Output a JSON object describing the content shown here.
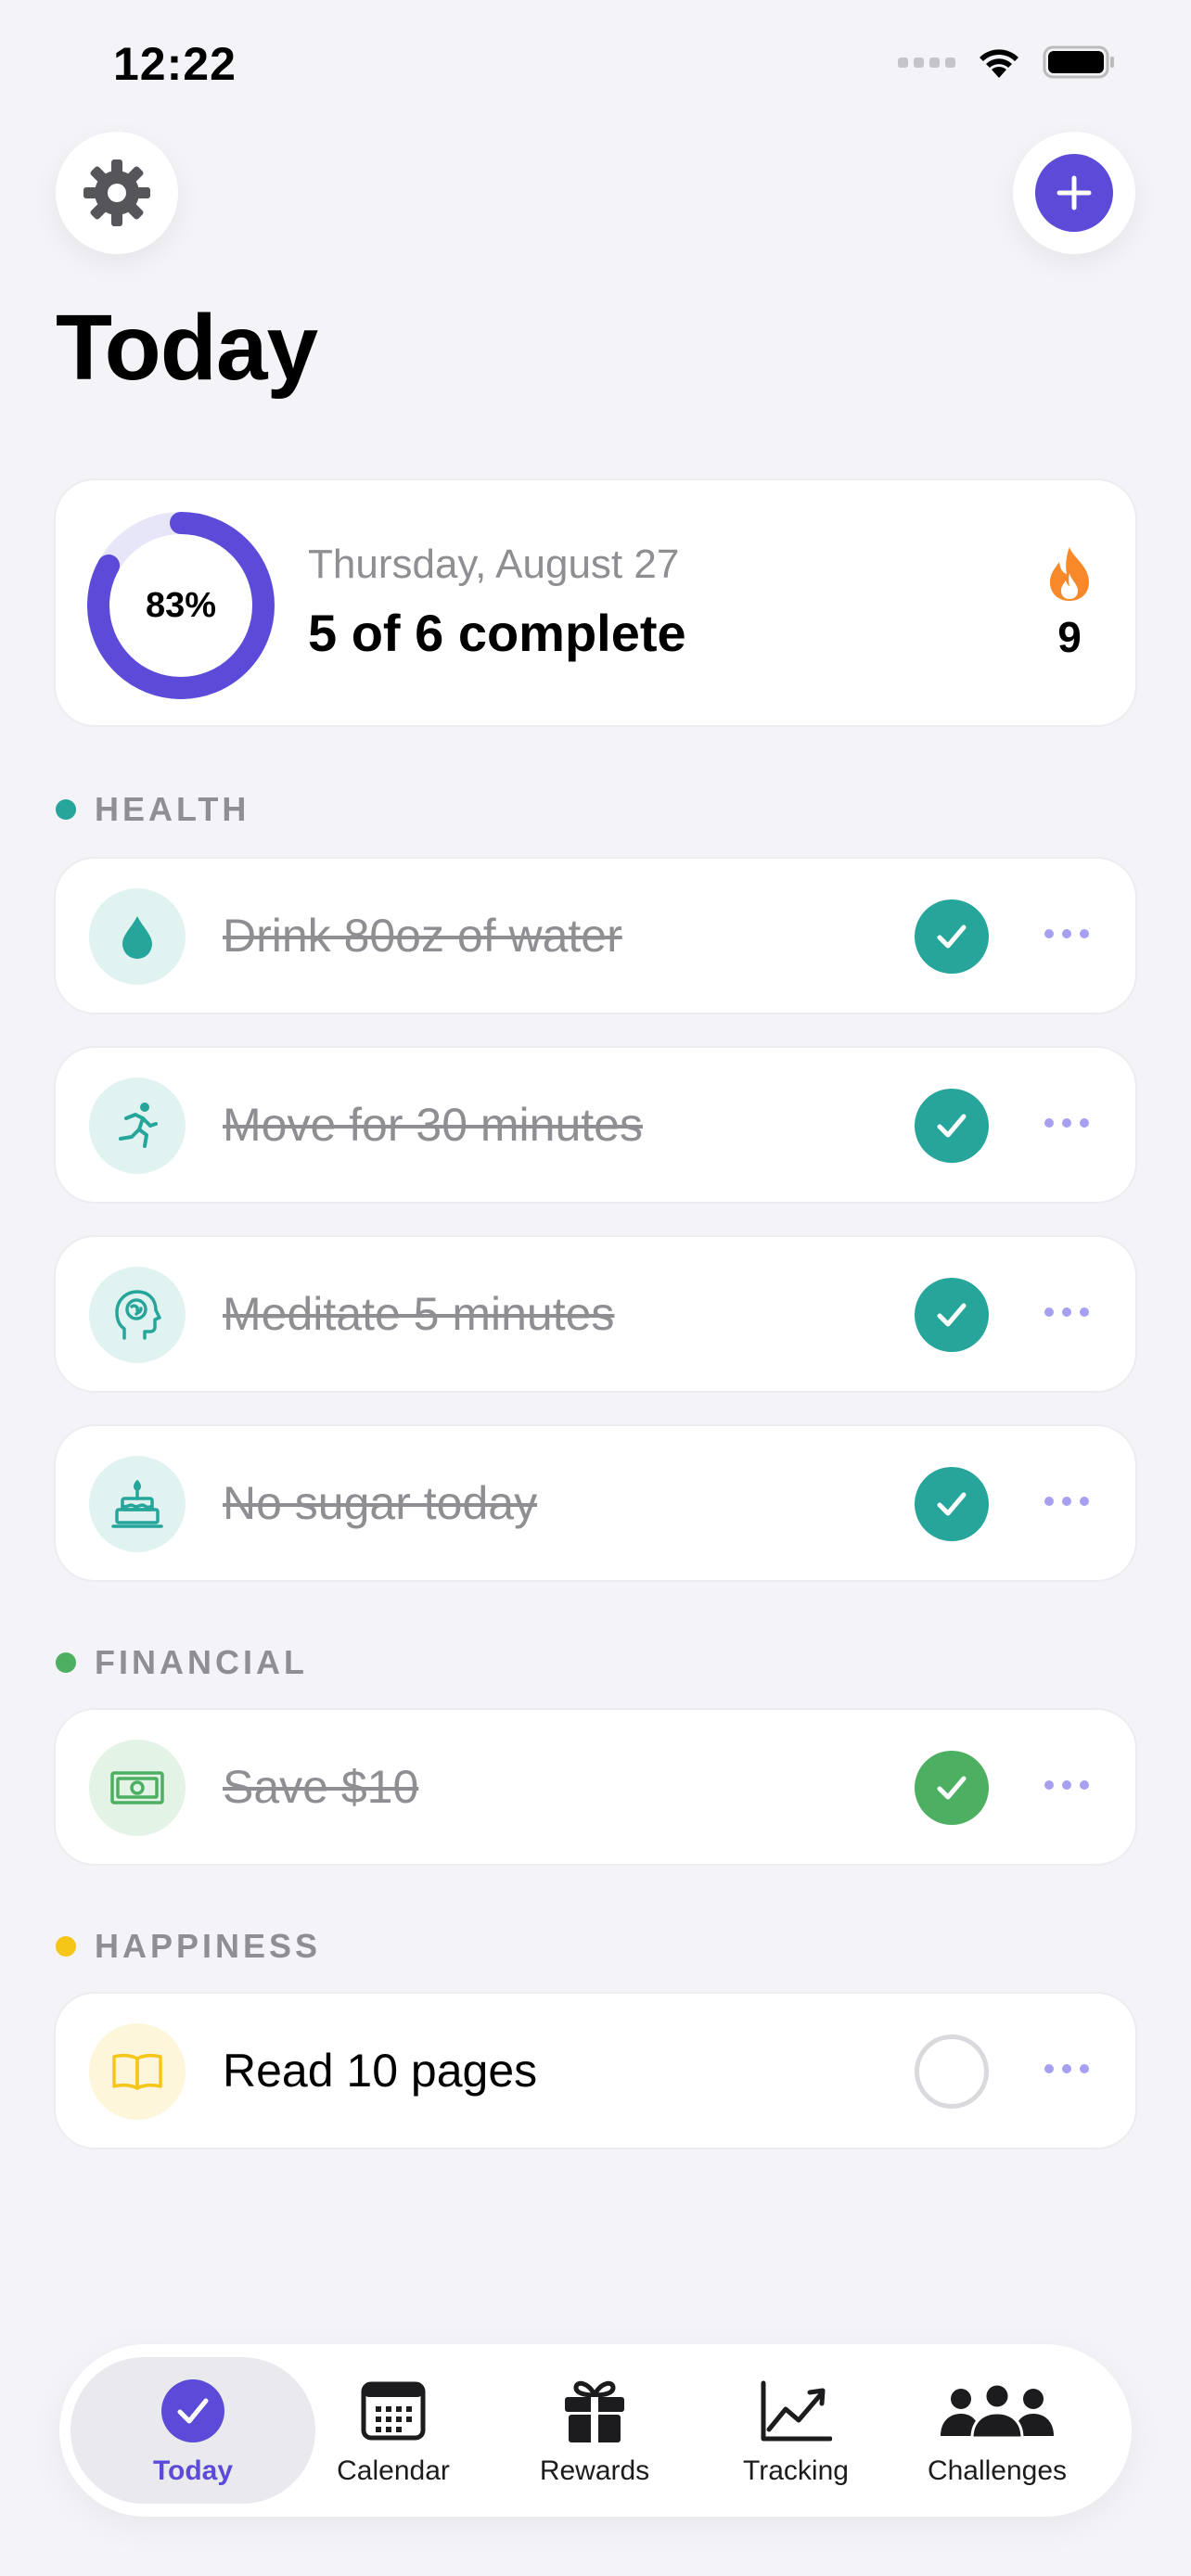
{
  "status_bar": {
    "time": "12:22"
  },
  "header": {
    "title": "Today"
  },
  "summary": {
    "percent_label": "83%",
    "percent_value": 0.83,
    "date": "Thursday, August 27",
    "progress_text": "5 of 6 complete",
    "streak": "9"
  },
  "sections": {
    "health": {
      "label": "HEALTH",
      "color": "#26a69a"
    },
    "financial": {
      "label": "FINANCIAL",
      "color": "#4caf62"
    },
    "happiness": {
      "label": "HAPPINESS",
      "color": "#f5c518"
    }
  },
  "habits": [
    {
      "label": "Drink 80oz of water",
      "done": true,
      "icon": "water-drop-icon"
    },
    {
      "label": "Move for 30 minutes",
      "done": true,
      "icon": "running-icon"
    },
    {
      "label": "Meditate 5 minutes",
      "done": true,
      "icon": "brain-head-icon"
    },
    {
      "label": "No sugar today",
      "done": true,
      "icon": "cake-icon"
    },
    {
      "label": "Save $10",
      "done": true,
      "icon": "cash-icon"
    },
    {
      "label": "Read 10 pages",
      "done": false,
      "icon": "book-icon"
    }
  ],
  "colors": {
    "accent": "#5b4bd8",
    "health_check": "#26a69a",
    "financial_check": "#4caf62",
    "streak": "#f7892b"
  },
  "tabs": [
    {
      "label": "Today",
      "icon": "checkmark-circle-icon",
      "active": true
    },
    {
      "label": "Calendar",
      "icon": "calendar-icon",
      "active": false
    },
    {
      "label": "Rewards",
      "icon": "gift-icon",
      "active": false
    },
    {
      "label": "Tracking",
      "icon": "chart-icon",
      "active": false
    },
    {
      "label": "Challenges",
      "icon": "people-icon",
      "active": false
    }
  ]
}
